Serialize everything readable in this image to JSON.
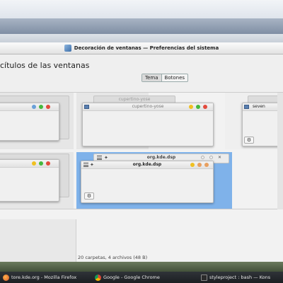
{
  "window": {
    "title": "Decoración de ventanas — Preferencias del sistema"
  },
  "page": {
    "heading": "cítulos de las ventanas"
  },
  "tabs": [
    {
      "label": "Tema",
      "active": true
    },
    {
      "label": "Botones",
      "active": false
    }
  ],
  "previews": [
    {
      "label": "",
      "selected": false
    },
    {
      "label": "cupertino-yose",
      "selected": false
    },
    {
      "label": "seven",
      "selected": false
    },
    {
      "label": "",
      "selected": false
    },
    {
      "label": "org.kde.dsp",
      "selected": true,
      "back_label": "org.kde.dsp"
    }
  ],
  "status": {
    "text": "20 carpetas, 4 archivos (48 B)"
  },
  "taskbar": {
    "items": [
      {
        "label": "tore.kde.org - Mozilla Firefox",
        "icon": "firefox-icon"
      },
      {
        "label": "Google - Google Chrome",
        "icon": "chrome-icon"
      },
      {
        "label": "styleproject : bash — Kons",
        "icon": "terminal-icon"
      }
    ]
  },
  "colors": {
    "selection": "#7fb2ea",
    "close": "#e24a3c",
    "maximize": "#45b83c",
    "minimize": "#f0c021"
  }
}
